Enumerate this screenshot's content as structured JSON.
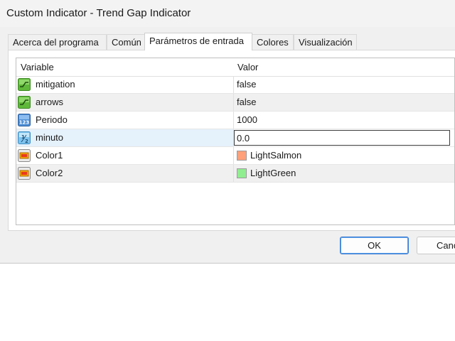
{
  "window": {
    "title": "Custom Indicator - Trend Gap Indicator"
  },
  "tabs": [
    {
      "label": "Acerca del programa",
      "active": false
    },
    {
      "label": "Común",
      "active": false
    },
    {
      "label": "Parámetros de entrada",
      "active": true
    },
    {
      "label": "Colores",
      "active": false
    },
    {
      "label": "Visualización",
      "active": false
    }
  ],
  "grid": {
    "headers": {
      "variable": "Variable",
      "value": "Valor"
    },
    "rows": [
      {
        "name": "mitigation",
        "value": "false",
        "icon": "bool-icon"
      },
      {
        "name": "arrows",
        "value": "false",
        "icon": "bool-icon"
      },
      {
        "name": "Periodo",
        "value": "1000",
        "icon": "integer-icon"
      },
      {
        "name": "minuto",
        "value": "0.0",
        "icon": "double-icon",
        "editing": true
      },
      {
        "name": "Color1",
        "value": "LightSalmon",
        "icon": "color-icon",
        "swatch": "#ffa07a"
      },
      {
        "name": "Color2",
        "value": "LightGreen",
        "icon": "color-icon",
        "swatch": "#90ee90"
      }
    ]
  },
  "buttons": {
    "ok": "OK",
    "cancel": "Canc"
  }
}
